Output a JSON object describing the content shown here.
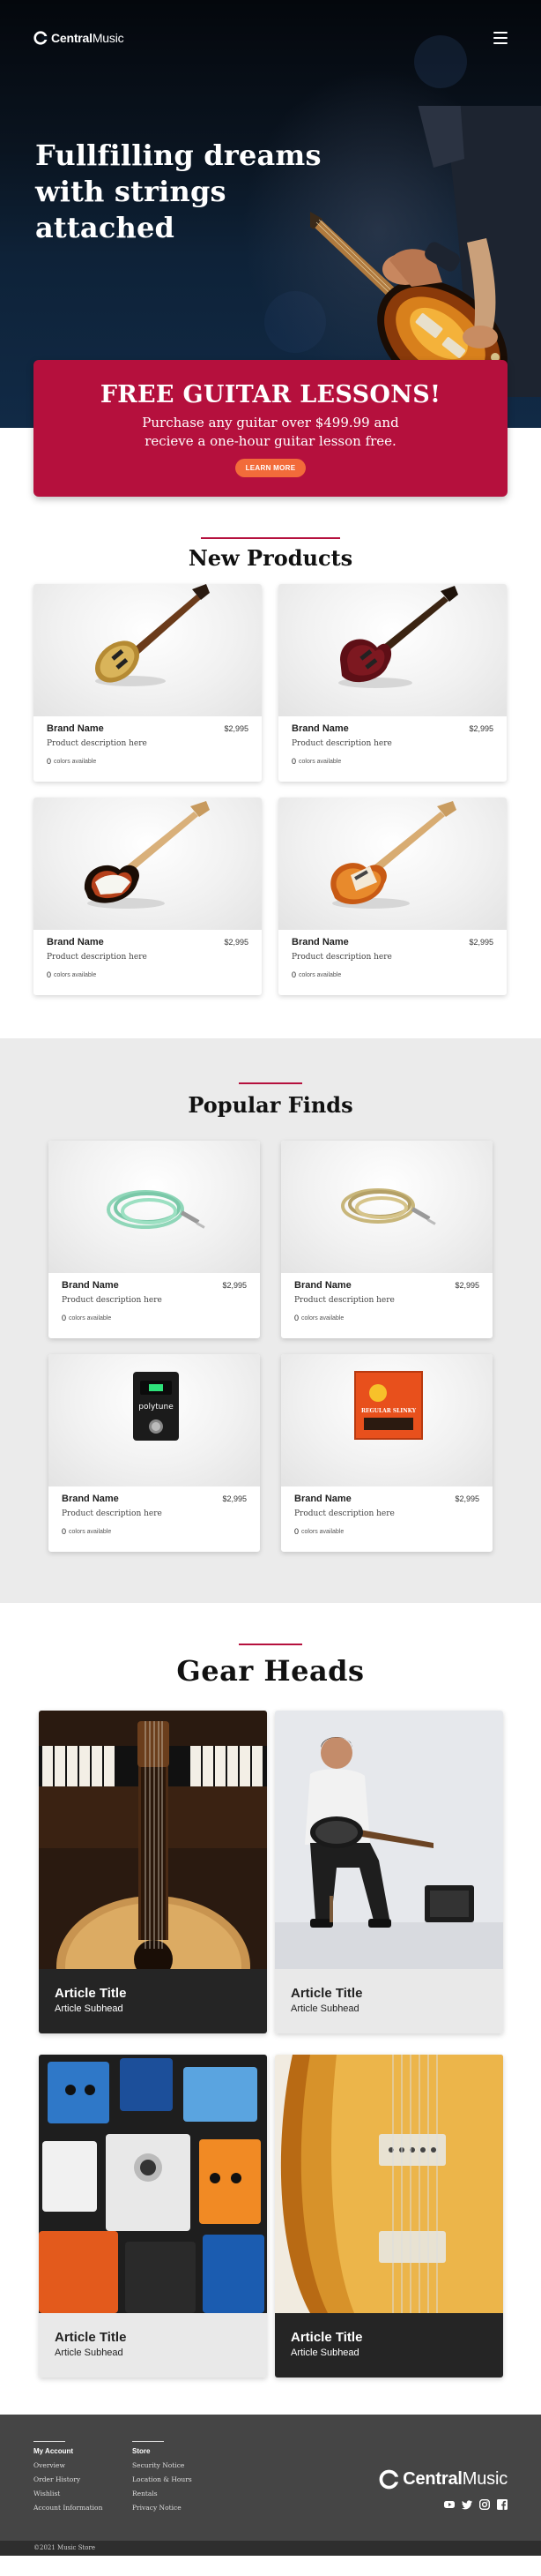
{
  "brand": {
    "name_bold": "Central",
    "name_regular": "Music"
  },
  "hero": {
    "title": "Fullfilling dreams with strings attached"
  },
  "promo": {
    "title": "FREE GUITAR LESSONS!",
    "text": "Purchase any guitar over $499.99 and recieve a one-hour guitar lesson free.",
    "button": "LEARN MORE"
  },
  "new_products": {
    "title": "New Products",
    "items": [
      {
        "brand": "Brand Name",
        "price": "$2,995",
        "description": "Product description here",
        "colors_count": "0",
        "colors_label": "colors available",
        "image": "gold-les-paul-guitar"
      },
      {
        "brand": "Brand Name",
        "price": "$2,995",
        "description": "Product description here",
        "colors_count": "0",
        "colors_label": "colors available",
        "image": "red-sg-guitar"
      },
      {
        "brand": "Brand Name",
        "price": "$2,995",
        "description": "Product description here",
        "colors_count": "0",
        "colors_label": "colors available",
        "image": "sunburst-strat-guitar"
      },
      {
        "brand": "Brand Name",
        "price": "$2,995",
        "description": "Product description here",
        "colors_count": "0",
        "colors_label": "colors available",
        "image": "orange-jazzmaster-guitar"
      }
    ]
  },
  "popular_finds": {
    "title": "Popular Finds",
    "items": [
      {
        "brand": "Brand Name",
        "price": "$2,995",
        "description": "Product description here",
        "colors_count": "0",
        "colors_label": "colors available",
        "image": "mint-instrument-cable"
      },
      {
        "brand": "Brand Name",
        "price": "$2,995",
        "description": "Product description here",
        "colors_count": "0",
        "colors_label": "colors available",
        "image": "tweed-instrument-cable"
      },
      {
        "brand": "Brand Name",
        "price": "$2,995",
        "description": "Product description here",
        "colors_count": "0",
        "colors_label": "colors available",
        "image": "polytune-tuner-pedal",
        "label_text": "polytune"
      },
      {
        "brand": "Brand Name",
        "price": "$2,995",
        "description": "Product description here",
        "colors_count": "0",
        "colors_label": "colors available",
        "image": "guitar-strings-pack",
        "label_text": "REGULAR SLINKY"
      }
    ]
  },
  "gear_heads": {
    "title": "Gear Heads",
    "articles": [
      {
        "title": "Article Title",
        "subhead": "Article Subhead",
        "theme": "dark",
        "image": "acoustic-guitar-piano"
      },
      {
        "title": "Article Title",
        "subhead": "Article Subhead",
        "theme": "light",
        "image": "man-playing-bass"
      },
      {
        "title": "Article Title",
        "subhead": "Article Subhead",
        "theme": "light",
        "image": "effects-pedalboard"
      },
      {
        "title": "Article Title",
        "subhead": "Article Subhead",
        "theme": "dark",
        "image": "les-paul-closeup"
      }
    ]
  },
  "footer": {
    "columns": [
      {
        "heading": "My Account",
        "links": [
          "Overview",
          "Order History",
          "Wishlist",
          "Account Information"
        ]
      },
      {
        "heading": "Store",
        "links": [
          "Security Notice",
          "Location & Hours",
          "Rentals",
          "Privacy Notice"
        ]
      }
    ],
    "socials": [
      "youtube-icon",
      "twitter-icon",
      "instagram-icon",
      "facebook-icon"
    ],
    "copyright": "©2021 Music Store"
  },
  "colors": {
    "accent": "#b5103d",
    "button": "#f26b3a",
    "footer": "#454545"
  }
}
